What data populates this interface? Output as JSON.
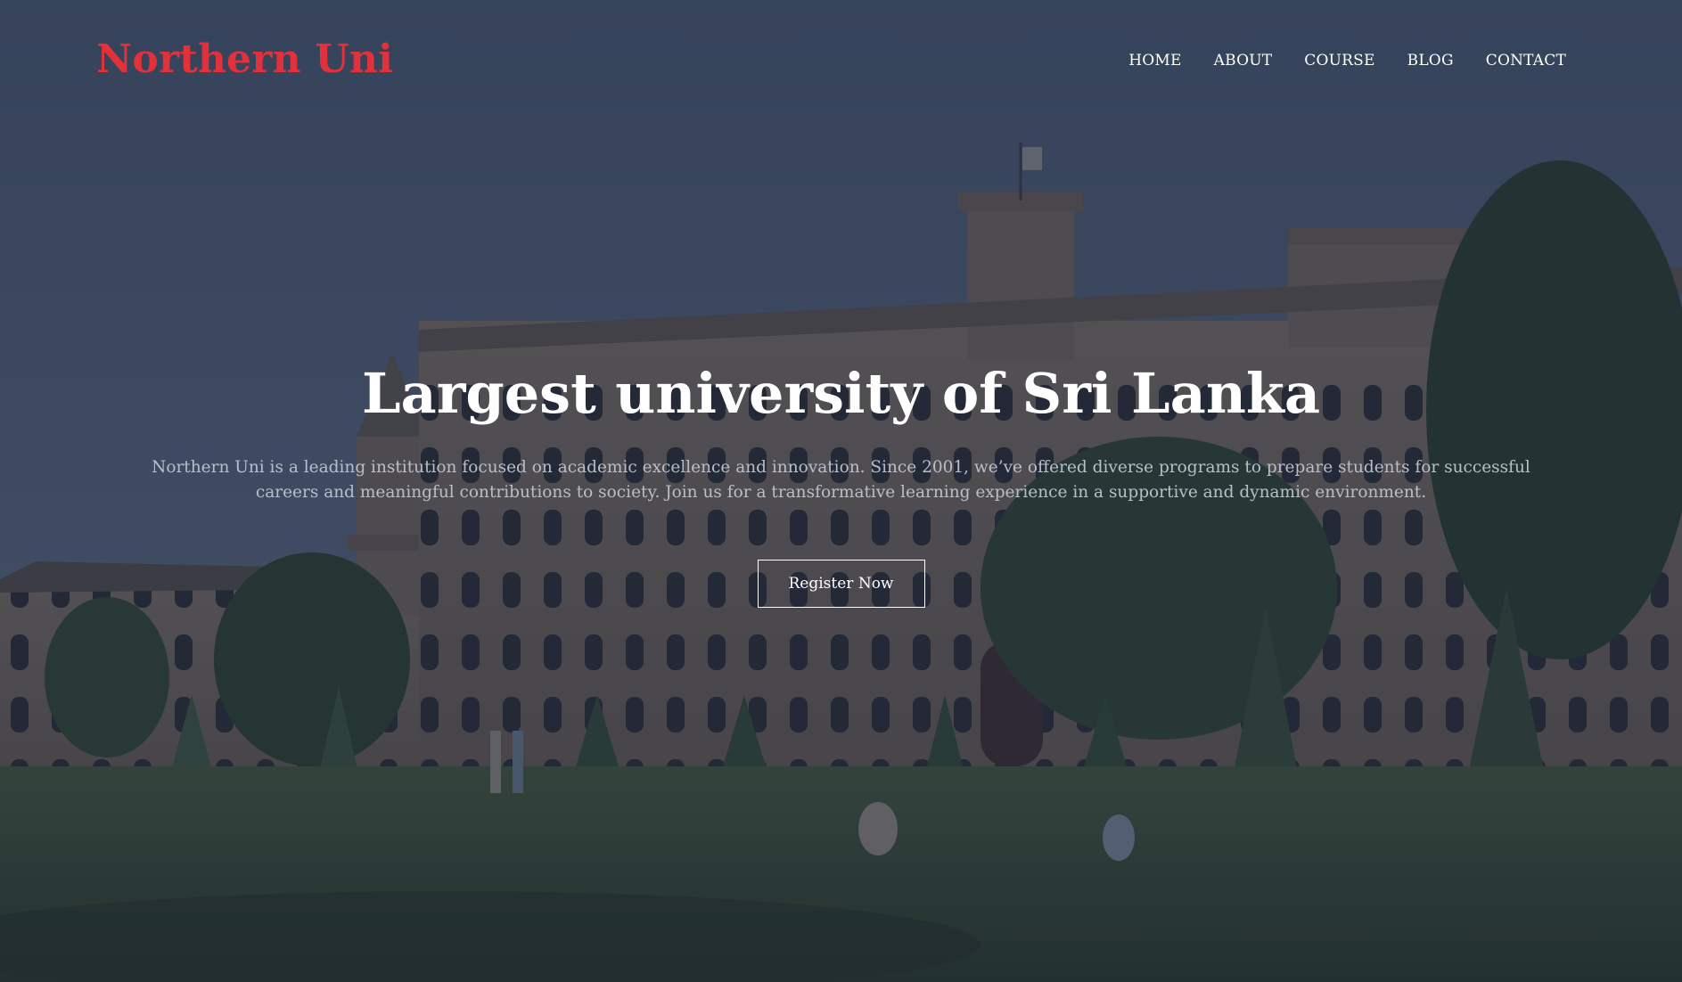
{
  "brand": {
    "name": "Northern Uni",
    "color": "#e1313b"
  },
  "nav": {
    "items": [
      {
        "label": "HOME"
      },
      {
        "label": "ABOUT"
      },
      {
        "label": "COURSE"
      },
      {
        "label": "BLOG"
      },
      {
        "label": "CONTACT"
      }
    ]
  },
  "hero": {
    "title": "Largest university of Sri Lanka",
    "description": "Northern Uni is a leading institution focused on academic excellence and innovation. Since 2001, we’ve offered diverse programs to prepare students for successful careers and meaningful contributions to society. Join us for a transformative learning experience in a supportive and dynamic environment.",
    "cta_label": "Register Now",
    "background_image": "campus-building-photo"
  },
  "colors": {
    "overlay": "#1f293e",
    "text_primary": "#ffffff",
    "text_muted": "#b9bfc9"
  }
}
